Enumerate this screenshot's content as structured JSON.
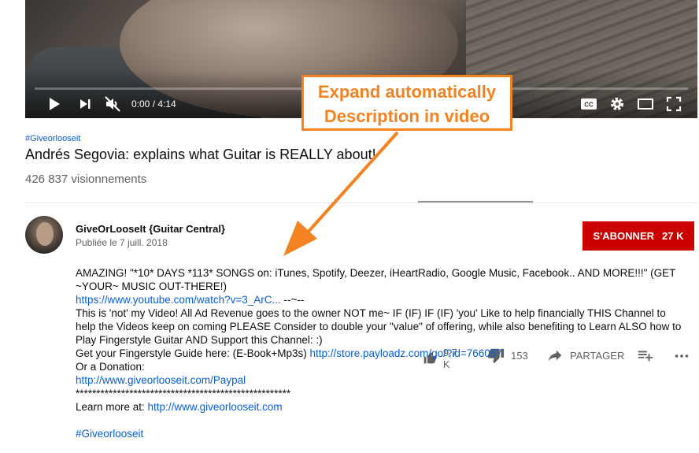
{
  "player": {
    "time": "0:00 / 4:14",
    "progress_fraction": 0.0
  },
  "annotation": {
    "line1": "Expand automatically",
    "line2": "Description in video",
    "color": "#f38221"
  },
  "video": {
    "hashtag": "#Giveorlooseit",
    "title": "Andrés Segovia: explains what Guitar is REALLY about!",
    "views": "426 837 visionnements"
  },
  "actions": {
    "likes": "9,7 K",
    "dislikes": "153",
    "share": "PARTAGER"
  },
  "channel": {
    "name": "GiveOrLooseIt {Guitar Central}",
    "published": "Publiée le 7 juill. 2018",
    "subscribe": "S'ABONNER",
    "subscribers": "27 K",
    "subscribe_color": "#cc0000"
  },
  "description": {
    "l1": "AMAZING! \"*10* DAYS *113* SONGS on: iTunes, Spotify, Deezer, iHeartRadio, Google Music, Facebook.. AND MORE!!!\" (GET",
    "l2": "~YOUR~ MUSIC OUT-THERE!)",
    "l3_link": "https://www.youtube.com/watch?v=3_ArC...",
    "l3_tail": " --~--",
    "l4": "This is 'not' my Video! All Ad Revenue goes to the owner NOT me~ IF (IF) IF (IF) 'you' Like to help financially THIS Channel to",
    "l5": "help the Videos keep on coming PLEASE Consider to double your \"value\" of offering, while also benefiting to Learn ALSO how to",
    "l6": "Play Fingerstyle Guitar AND Support this Channel:  :)",
    "l7_text": "Get your Fingerstyle Guide here:  (E-Book+Mp3s)  ",
    "l7_link": "http://store.payloadz.com/go/?id=766057",
    "l8": "Or a Donation:",
    "l9_link": "http://www.giveorlooseit.com/Paypal",
    "l10": "****************************************************",
    "l11_text": "Learn more at: ",
    "l11_link": "http://www.giveorlooseit.com",
    "hashtag": "#Giveorlooseit"
  }
}
